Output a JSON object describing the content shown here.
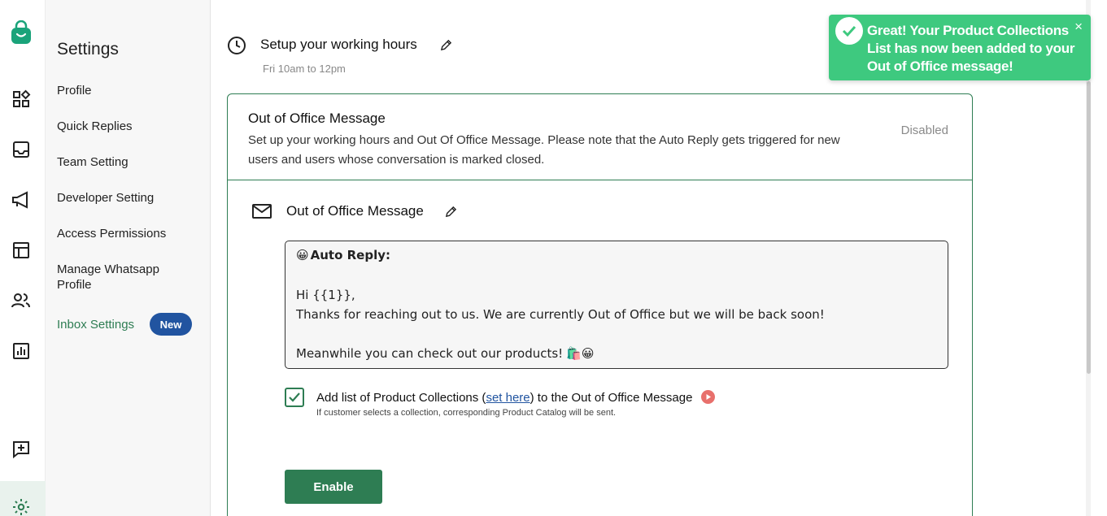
{
  "rail": {
    "icons": [
      "app-logo-icon",
      "widgets-icon",
      "inbox-icon",
      "megaphone-icon",
      "layout-icon",
      "contacts-icon",
      "analytics-icon",
      "feedback-icon",
      "settings-gear-icon"
    ]
  },
  "sidebar": {
    "title": "Settings",
    "items": [
      {
        "label": "Profile"
      },
      {
        "label": "Quick Replies"
      },
      {
        "label": "Team Setting"
      },
      {
        "label": "Developer Setting"
      },
      {
        "label": "Access Permissions"
      },
      {
        "label": "Manage Whatsapp Profile"
      },
      {
        "label": "Inbox Settings"
      }
    ],
    "new_badge": "New"
  },
  "working_hours": {
    "title": "Setup your working hours",
    "schedule": "Fri 10am to 12pm"
  },
  "card": {
    "title": "Out of Office Message",
    "description": "Set up your working hours and Out Of Office Message. Please note that the Auto Reply gets triggered for new users and users whose conversation is marked closed.",
    "status": "Disabled",
    "section_title": "Out of Office Message",
    "message": {
      "header_emoji": "😀",
      "header": "Auto Reply:",
      "greeting": "Hi {{1}},",
      "body": "Thanks for reaching out to us. We are currently Out of Office but we will be back soon!",
      "footer": "Meanwhile you can check out our products!",
      "footer_emoji": "🛍️😀"
    },
    "checkbox": {
      "checked": true,
      "label_before": "Add list of Product Collections (",
      "link": "set here",
      "label_after": ") to the Out of Office Message",
      "note": "If customer selects a collection, corresponding Product Catalog will be sent."
    },
    "enable_button": "Enable"
  },
  "toast": {
    "message": "Great! Your Product Collections List has now been added to your Out of Office message!",
    "close": "×"
  },
  "colors": {
    "brand_green": "#2e7d53",
    "toast_green": "#3ec97f",
    "badge_blue": "#2154a0"
  }
}
